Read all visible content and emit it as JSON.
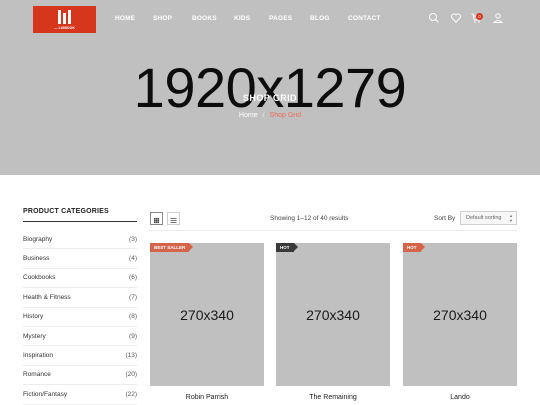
{
  "header": {
    "logo_text": "— LIGBOOK",
    "nav": [
      "HOME",
      "SHOP",
      "BOOKS",
      "KIDS",
      "PAGES",
      "BLOG",
      "CONTACT"
    ],
    "cart_count": "0",
    "icons": [
      "search-icon",
      "heart-icon",
      "cart-icon",
      "user-icon"
    ]
  },
  "hero": {
    "placeholder": "1920x1279",
    "title": "SHOP GRID",
    "breadcrumb": {
      "home": "Home",
      "separator": "/",
      "current": "Shop Grid"
    }
  },
  "sidebar": {
    "title": "PRODUCT CATEGORIES",
    "categories": [
      {
        "name": "Biography",
        "count": "(3)"
      },
      {
        "name": "Business",
        "count": "(4)"
      },
      {
        "name": "Cookbooks",
        "count": "(6)"
      },
      {
        "name": "Health & Fitness",
        "count": "(7)"
      },
      {
        "name": "History",
        "count": "(8)"
      },
      {
        "name": "Mystery",
        "count": "(9)"
      },
      {
        "name": "Inspiration",
        "count": "(13)"
      },
      {
        "name": "Romance",
        "count": "(20)"
      },
      {
        "name": "Fiction/Fantasy",
        "count": "(22)"
      }
    ]
  },
  "toolbar": {
    "result_count": "Showing 1–12 of 40 results",
    "sort_label": "Sort By",
    "sort_value": "Default sorting"
  },
  "products": [
    {
      "tag": "BEST SALLER",
      "tag_color": "#d5654a",
      "image_text": "270x340",
      "name": "Robin Parrish"
    },
    {
      "tag": "HOT",
      "tag_color": "#3a3a3a",
      "image_text": "270x340",
      "name": "The Remaining"
    },
    {
      "tag": "HOT",
      "tag_color": "#d5654a",
      "image_text": "270x340",
      "name": "Lando"
    }
  ],
  "colors": {
    "accent": "#d5361c",
    "hero_bg": "#c0c0c0",
    "breadcrumb_current": "#e8705a"
  }
}
